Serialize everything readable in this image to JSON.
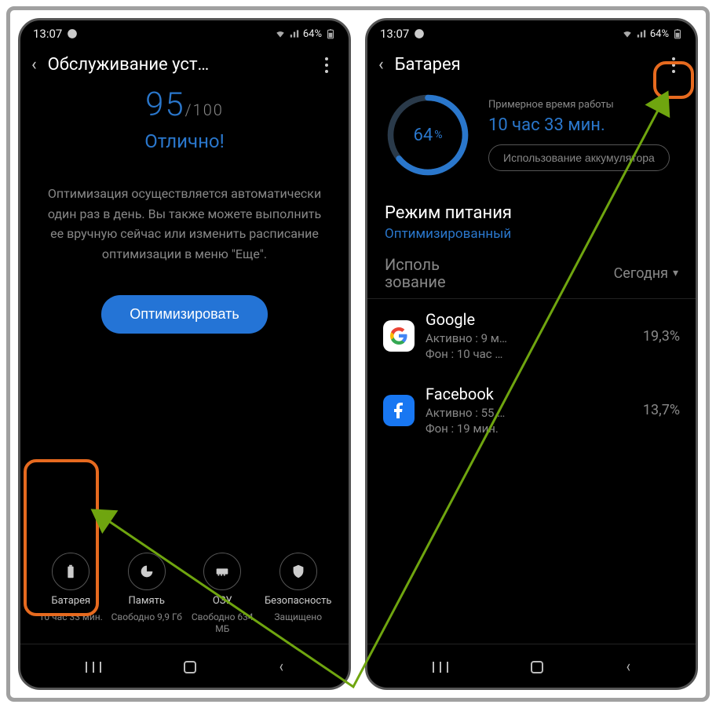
{
  "statusbar": {
    "time": "13:07",
    "battery_text": "64%"
  },
  "screen1": {
    "title": "Обслуживание уст…",
    "score": "95",
    "score_denom": "/100",
    "status_word": "Отлично!",
    "description": "Оптимизация осуществляется автоматически один раз в день. Вы также можете выполнить ее вручную сейчас или изменить расписание оптимизации в меню \"Еще\".",
    "optimize_button": "Оптимизировать",
    "tiles": {
      "battery": {
        "label": "Батарея",
        "sub": "10 час 33 мин."
      },
      "storage": {
        "label": "Память",
        "sub": "Свободно 9,9 Гб"
      },
      "ram": {
        "label": "ОЗУ",
        "sub": "Свободно 634 МБ"
      },
      "security": {
        "label": "Безопасность",
        "sub": "Защищено"
      }
    }
  },
  "screen2": {
    "title": "Батарея",
    "ring_percent": "64",
    "ring_pct_sym": "%",
    "est_label": "Примерное время работы",
    "est_time": "10 час 33 мин.",
    "usage_button": "Использование аккумулятора",
    "power_mode_header": "Режим питания",
    "power_mode_value": "Оптимизированный",
    "usage_label_line1": "Исполь",
    "usage_label_line2": "зование",
    "usage_period": "Сегодня",
    "apps": [
      {
        "name": "Google",
        "active": "Активно : 9 м…",
        "bg": "Фон : 10 час …",
        "pct": "19,3%"
      },
      {
        "name": "Facebook",
        "active": "Активно : 55 …",
        "bg": "Фон : 19 мин.",
        "pct": "13,7%"
      }
    ]
  }
}
